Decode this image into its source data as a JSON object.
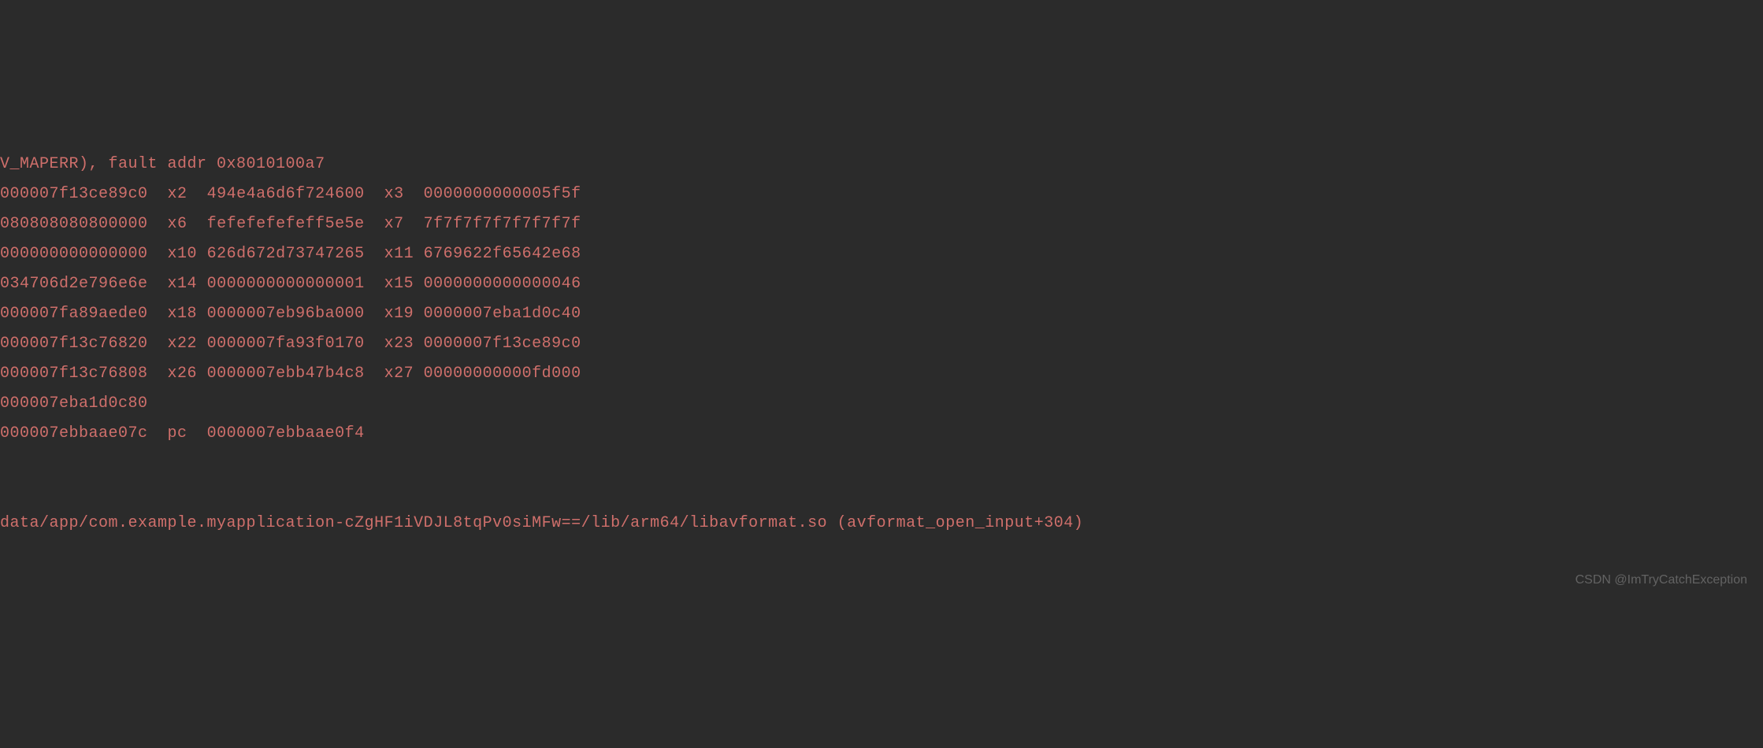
{
  "crash_log": {
    "signal_line": "V_MAPERR), fault addr 0x8010100a7",
    "registers": [
      {
        "col0": "000007f13ce89c0",
        "reg1": "x2",
        "val1": "494e4a6d6f724600",
        "reg2": "x3",
        "val2": "0000000000005f5f"
      },
      {
        "col0": "080808080800000",
        "reg1": "x6",
        "val1": "fefefefefeff5e5e",
        "reg2": "x7",
        "val2": "7f7f7f7f7f7f7f7f"
      },
      {
        "col0": "000000000000000",
        "reg1": "x10",
        "val1": "626d672d73747265",
        "reg2": "x11",
        "val2": "6769622f65642e68"
      },
      {
        "col0": "034706d2e796e6e",
        "reg1": "x14",
        "val1": "0000000000000001",
        "reg2": "x15",
        "val2": "0000000000000046"
      },
      {
        "col0": "000007fa89aede0",
        "reg1": "x18",
        "val1": "0000007eb96ba000",
        "reg2": "x19",
        "val2": "0000007eba1d0c40"
      },
      {
        "col0": "000007f13c76820",
        "reg1": "x22",
        "val1": "0000007fa93f0170",
        "reg2": "x23",
        "val2": "0000007f13ce89c0"
      },
      {
        "col0": "000007f13c76808",
        "reg1": "x26",
        "val1": "0000007ebb47b4c8",
        "reg2": "x27",
        "val2": "00000000000fd000"
      }
    ],
    "single_registers": [
      {
        "col0": "000007eba1d0c80"
      },
      {
        "col0": "000007ebbaae07c",
        "reg1": "pc",
        "val1": "0000007ebbaae0f4"
      }
    ],
    "backtrace": "data/app/com.example.myapplication-cZgHF1iVDJL8tqPv0siMFw==/lib/arm64/libavformat.so (avformat_open_input+304)"
  },
  "watermark": "CSDN @ImTryCatchException"
}
